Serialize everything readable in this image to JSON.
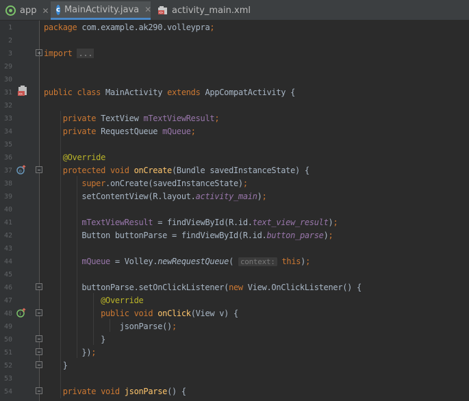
{
  "tabs": [
    {
      "label": "app",
      "icon": "android-module-icon",
      "closable": true
    },
    {
      "label": "MainActivity.java",
      "icon": "java-class-icon",
      "closable": true,
      "active": true
    },
    {
      "label": "activity_main.xml",
      "icon": "xml-layout-icon",
      "closable": false
    }
  ],
  "lines": [
    {
      "n": "1",
      "tokens": [
        [
          "kw",
          "package "
        ],
        [
          "",
          "com.example.ak290.volleypra"
        ],
        [
          "kw",
          ";"
        ]
      ]
    },
    {
      "n": "2",
      "tokens": []
    },
    {
      "n": "3",
      "tokens": [
        [
          "kw",
          "import "
        ],
        [
          "fold",
          "..."
        ]
      ]
    },
    {
      "n": "29",
      "tokens": []
    },
    {
      "n": "30",
      "tokens": []
    },
    {
      "n": "31",
      "tokens": [
        [
          "kw",
          "public class "
        ],
        [
          "",
          "MainActivity "
        ],
        [
          "kw",
          "extends "
        ],
        [
          "",
          "AppCompatActivity {"
        ]
      ]
    },
    {
      "n": "32",
      "tokens": []
    },
    {
      "n": "33",
      "tokens": [
        [
          "",
          "    "
        ],
        [
          "kw",
          "private "
        ],
        [
          "",
          "TextView "
        ],
        [
          "fld",
          "mTextViewResult"
        ],
        [
          "kw",
          ";"
        ]
      ]
    },
    {
      "n": "34",
      "tokens": [
        [
          "",
          "    "
        ],
        [
          "kw",
          "private "
        ],
        [
          "",
          "RequestQueue "
        ],
        [
          "fld",
          "mQueue"
        ],
        [
          "kw",
          ";"
        ]
      ]
    },
    {
      "n": "35",
      "tokens": []
    },
    {
      "n": "36",
      "tokens": [
        [
          "",
          "    "
        ],
        [
          "ann",
          "@Override"
        ]
      ]
    },
    {
      "n": "37",
      "tokens": [
        [
          "",
          "    "
        ],
        [
          "kw",
          "protected void "
        ],
        [
          "fn",
          "onCreate"
        ],
        [
          "",
          "(Bundle savedInstanceState) {"
        ]
      ]
    },
    {
      "n": "38",
      "tokens": [
        [
          "",
          "        "
        ],
        [
          "kw",
          "super"
        ],
        [
          "",
          ".onCreate(savedInstanceState)"
        ],
        [
          "kw",
          ";"
        ]
      ]
    },
    {
      "n": "39",
      "tokens": [
        [
          "",
          "        setContentView(R.layout."
        ],
        [
          "fldi",
          "activity_main"
        ],
        [
          "",
          ")"
        ],
        [
          "kw",
          ";"
        ]
      ]
    },
    {
      "n": "40",
      "tokens": []
    },
    {
      "n": "41",
      "tokens": [
        [
          "",
          "        "
        ],
        [
          "fld",
          "mTextViewResult "
        ],
        [
          "",
          "= findViewById(R.id."
        ],
        [
          "fldi",
          "text_view_result"
        ],
        [
          "",
          ")"
        ],
        [
          "kw",
          ";"
        ]
      ]
    },
    {
      "n": "42",
      "tokens": [
        [
          "",
          "        Button buttonParse = findViewById(R.id."
        ],
        [
          "fldi",
          "button_parse"
        ],
        [
          "",
          ")"
        ],
        [
          "kw",
          ";"
        ]
      ]
    },
    {
      "n": "43",
      "tokens": []
    },
    {
      "n": "44",
      "tokens": [
        [
          "",
          "        "
        ],
        [
          "fld",
          "mQueue "
        ],
        [
          "",
          "= Volley."
        ],
        [
          "ital",
          "newRequestQueue"
        ],
        [
          "",
          "( "
        ],
        [
          "hint",
          "context:"
        ],
        [
          "",
          ""
        ],
        [
          "kw",
          " this"
        ],
        [
          "",
          ")"
        ],
        [
          "kw",
          ";"
        ]
      ]
    },
    {
      "n": "45",
      "tokens": []
    },
    {
      "n": "46",
      "tokens": [
        [
          "",
          "        buttonParse.setOnClickListener("
        ],
        [
          "kw",
          "new "
        ],
        [
          "",
          "View.OnClickListener() {"
        ]
      ]
    },
    {
      "n": "47",
      "tokens": [
        [
          "",
          "            "
        ],
        [
          "ann",
          "@Override"
        ]
      ]
    },
    {
      "n": "48",
      "tokens": [
        [
          "",
          "            "
        ],
        [
          "kw",
          "public void "
        ],
        [
          "fn",
          "onClick"
        ],
        [
          "",
          "(View v) {"
        ]
      ]
    },
    {
      "n": "49",
      "tokens": [
        [
          "",
          "                jsonParse()"
        ],
        [
          "kw",
          ";"
        ]
      ]
    },
    {
      "n": "50",
      "tokens": [
        [
          "",
          "            }"
        ]
      ]
    },
    {
      "n": "51",
      "tokens": [
        [
          "",
          "        })"
        ],
        [
          "kw",
          ";"
        ]
      ]
    },
    {
      "n": "52",
      "tokens": [
        [
          "",
          "    }"
        ]
      ]
    },
    {
      "n": "53",
      "tokens": []
    },
    {
      "n": "54",
      "tokens": [
        [
          "",
          "    "
        ],
        [
          "kw",
          "private void "
        ],
        [
          "fn",
          "jsonParse"
        ],
        [
          "",
          "() {"
        ]
      ]
    }
  ]
}
